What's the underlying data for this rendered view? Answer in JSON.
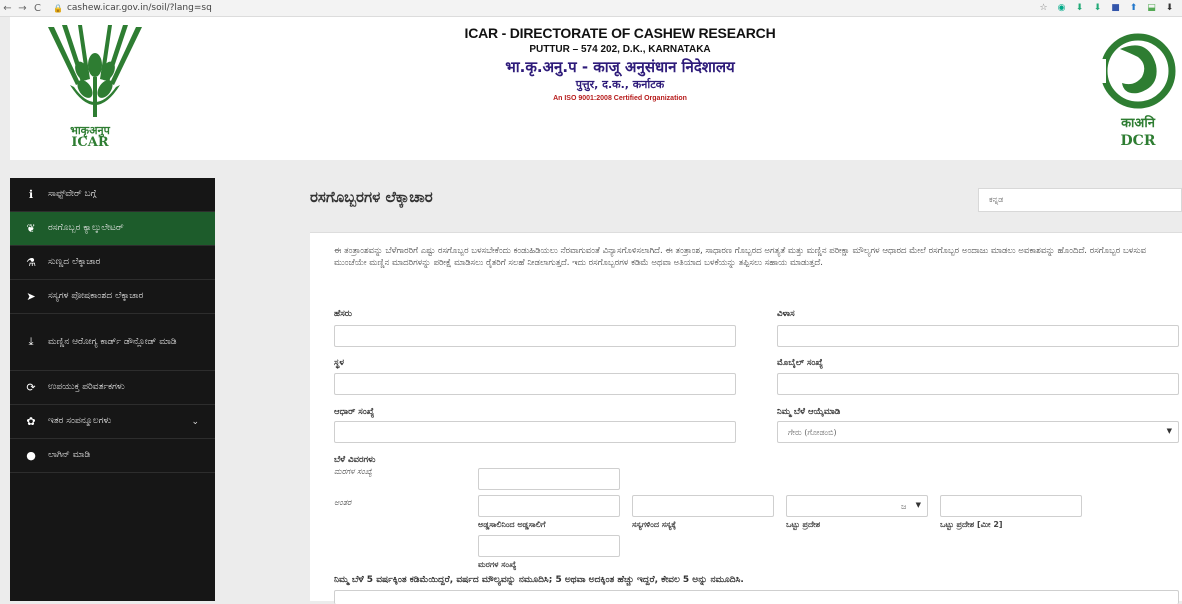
{
  "browser": {
    "url": "cashew.icar.gov.in/soil/?lang=sq",
    "back": "←",
    "forward": "→",
    "reload": "C",
    "icons": [
      "star-icon",
      "extension-icon",
      "extension-icon",
      "extension-icon",
      "extension-icon",
      "extension-icon",
      "extension-icon",
      "extension-icon"
    ]
  },
  "header": {
    "left_logo_text1": "भाकृअनुप",
    "left_logo_text2": "ICAR",
    "title_line1": "ICAR - DIRECTORATE OF CASHEW RESEARCH",
    "title_line2": "PUTTUR – 574 202, D.K., KARNATAKA",
    "title_line3": "भा.कृ.अनु.प - काजू अनुसंधान निदेशालय",
    "title_line4": "पुत्तुर, द.क., कर्नाटक",
    "title_line5": "An ISO 9001:2008 Certified Organization",
    "right_logo_text1": "काअनि",
    "right_logo_text2": "DCR",
    "colors": {
      "green": "#2e7d32",
      "purple": "#2e1b7a",
      "red": "#b71c1c"
    }
  },
  "sidebar": {
    "items": [
      {
        "icon": "info-icon",
        "glyph": "ℹ",
        "label": "ಸಾಫ್ಟ್‌ವೇರ್ ಬಗ್ಗೆ"
      },
      {
        "icon": "leaf-icon",
        "glyph": "❦",
        "label": "ರಸಗೊಬ್ಬರ ಕ್ಯಾಲ್ಕುಲೇಟರ್"
      },
      {
        "icon": "lime-icon",
        "glyph": "⚗",
        "label": "ಸುಣ್ಣದ ಲೆಕ್ಕಾಚಾರ"
      },
      {
        "icon": "plant-nutrient-icon",
        "glyph": "➤",
        "label": "ಸಸ್ಯಗಳ ಪೋಷಕಾಂಶದ ಲೆಕ್ಕಾಚಾರ"
      },
      {
        "icon": "download-card-icon",
        "glyph": "⤓",
        "label": "ಮಣ್ಣಿನ ಆರೋಗ್ಯ ಕಾರ್ಡ್ ಡೌನ್ಲೋಡ್ ಮಾಡಿ"
      },
      {
        "icon": "refresh-icon",
        "glyph": "⟳",
        "label": "ಉಪಯುಕ್ತ ಪರಿವರ್ತಕಗಳು"
      },
      {
        "icon": "resources-icon",
        "glyph": "✿",
        "label": "ಇತರ ಸಂಪನ್ಮೂಲಗಳು"
      },
      {
        "icon": "user-icon",
        "glyph": "●",
        "label": "ಲಾಗಿನ್ ಮಾಡಿ"
      }
    ],
    "active_index": 1,
    "active_color": "#1d5c2b"
  },
  "main": {
    "title": "ರಸಗೊಬ್ಬರಗಳ ಲೆಕ್ಕಾಚಾರ",
    "language": "ಕನ್ನಡ",
    "intro": "ಈ ತಂತ್ರಾಂಶವನ್ನು ಬೆಳೆಗಾರರಿಗೆ ಎಷ್ಟು ರಸಗೊಬ್ಬರ ಬಳಸಬೇಕೆಂದು ಕಂಡುಹಿಡಿಯಲು ನೆರವಾಗುವಂತೆ ವಿನ್ಯಾಸಗೊಳಿಸಲಾಗಿದೆ. ಈ ತಂತ್ರಾಂಶ, ಸಾಧಾರಣ ಗೊಬ್ಬರದ ಅಗತ್ಯತೆ ಮತ್ತು ಮಣ್ಣಿನ ಪರೀಕ್ಷಾ ಮೌಲ್ಯಗಳ ಆಧಾರದ ಮೇಲೆ ರಸಗೊಬ್ಬರ ಅಂದಾಜು ಮಾಡಲು ಅವಕಾಶವನ್ನು ಹೊಂದಿದೆ. ರಸಗೊಬ್ಬರ ಬಳಸುವ ಮುಂಚೆಯೇ ಮಣ್ಣಿನ ಮಾದರಿಗಳನ್ನು ಪರೀಕ್ಷೆ ಮಾಡಿಸಲು ರೈತರಿಗೆ ಸಲಹೆ ನೀಡಲಾಗುತ್ತದೆ. ಇದು ರಸಗೊಬ್ಬರಗಳ ಕಡಿಮೆ ಅಥವಾ ಅತಿಯಾದ ಬಳಕೆಯನ್ನು ತಪ್ಪಿಸಲು ಸಹಾಯ ಮಾಡುತ್ತದೆ.",
    "form": {
      "name_label": "ಹೆಸರು",
      "address_label": "ವಿಳಾಸ",
      "place_label": "ಸ್ಥಳ",
      "mobile_label": "ಮೊಬೈಲ್ ಸಂಖ್ಯೆ",
      "aadhar_label": "ಆಧಾರ್ ಸಂಖ್ಯೆ",
      "crop_label": "ನಿಮ್ಮ ಬೆಳೆ ಆಯ್ಕೆಮಾಡಿ",
      "crop_value": "ಗೇರು (ಗೋಡಂಬಿ)",
      "crop_details_label": "ಬೆಳೆ ವಿವರಗಳು",
      "trees_count_label": "ಮರಗಳ ಸಂಖ್ಯೆ",
      "spacing_label": "ಅಂತರ",
      "row_to_row": "ಅಡ್ಡಸಾಲಿನಿಂದ ಅಡ್ಡಸಾಲಿಗೆ",
      "plant_to_plant": "ಸಸ್ಯಗಳಿಂದ ಸಸ್ಯಕ್ಕೆ",
      "unit_value": "ಜ",
      "total_area": "ಒಟ್ಟು ಪ್ರದೇಶ",
      "total_area_m2": "ಒಟ್ಟು ಪ್ರದೇಶ [ಮೀ 2]",
      "trees_count_caption": "ಮರಗಳ ಸಂಖ್ಯೆ",
      "age_note": "ನಿಮ್ಮ ಬೆಳೆ 5 ವರ್ಷಕ್ಕಿಂತ ಕಡಿಮೆಯಿದ್ದರೆ, ವರ್ಷದ ಮೌಲ್ಯವನ್ನು ನಮೂದಿಸಿ; 5 ಅಥವಾ ಅದಕ್ಕಿಂತ ಹೆಚ್ಚು ಇದ್ದರೆ, ಕೇವಲ 5 ಅನ್ನು ನಮೂದಿಸಿ."
    }
  }
}
